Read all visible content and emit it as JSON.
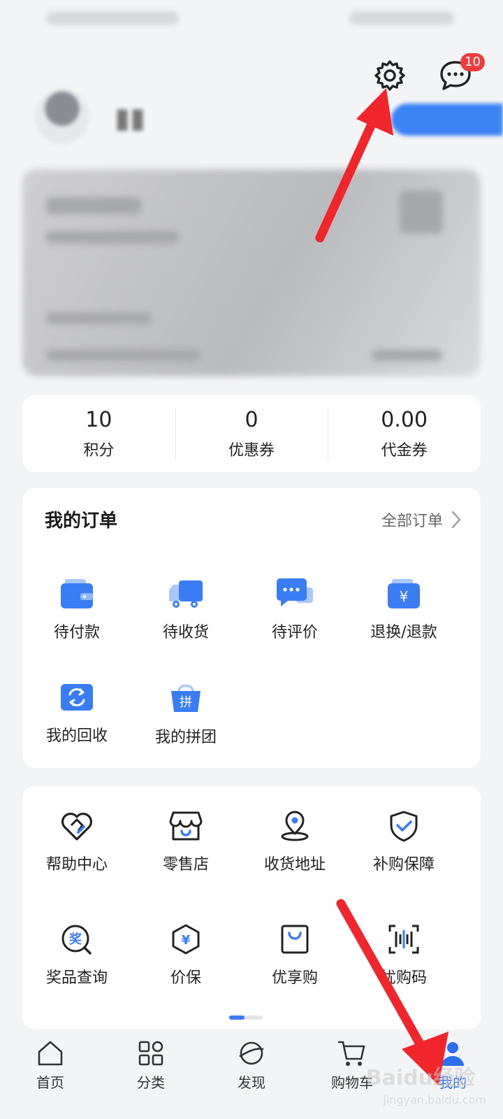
{
  "header": {
    "messages_badge": "10"
  },
  "stats": [
    {
      "value": "10",
      "label": "积分"
    },
    {
      "value": "0",
      "label": "优惠券"
    },
    {
      "value": "0.00",
      "label": "代金券"
    }
  ],
  "orders": {
    "title": "我的订单",
    "all_label": "全部订单",
    "items": [
      {
        "label": "待付款",
        "icon": "wallet-icon"
      },
      {
        "label": "待收货",
        "icon": "truck-icon"
      },
      {
        "label": "待评价",
        "icon": "comment-icon"
      },
      {
        "label": "退换/退款",
        "icon": "refund-icon"
      },
      {
        "label": "我的回收",
        "icon": "recycle-icon"
      },
      {
        "label": "我的拼团",
        "icon": "group-buy-icon",
        "glyph": "拼"
      }
    ]
  },
  "services": {
    "items": [
      {
        "label": "帮助中心",
        "icon": "heart-handshake-icon"
      },
      {
        "label": "零售店",
        "icon": "store-icon"
      },
      {
        "label": "收货地址",
        "icon": "location-pin-icon"
      },
      {
        "label": "补购保障",
        "icon": "shield-check-icon"
      },
      {
        "label": "奖品查询",
        "icon": "prize-search-icon",
        "glyph": "奖"
      },
      {
        "label": "价保",
        "icon": "price-protect-icon",
        "glyph": "¥"
      },
      {
        "label": "优享购",
        "icon": "shopping-bag-icon"
      },
      {
        "label": "忧购码",
        "icon": "barcode-icon"
      }
    ]
  },
  "tabbar": [
    {
      "label": "首页",
      "icon": "home-icon"
    },
    {
      "label": "分类",
      "icon": "category-icon"
    },
    {
      "label": "发现",
      "icon": "discover-icon"
    },
    {
      "label": "购物车",
      "icon": "cart-icon"
    },
    {
      "label": "我的",
      "icon": "profile-icon",
      "active": true
    }
  ],
  "watermark": {
    "main": "Baidu经验",
    "sub": "jingyan.baidu.com"
  },
  "colors": {
    "accent": "#2b6ef0",
    "badge": "#ef3b3b",
    "annotation_arrow": "#f0262c"
  }
}
